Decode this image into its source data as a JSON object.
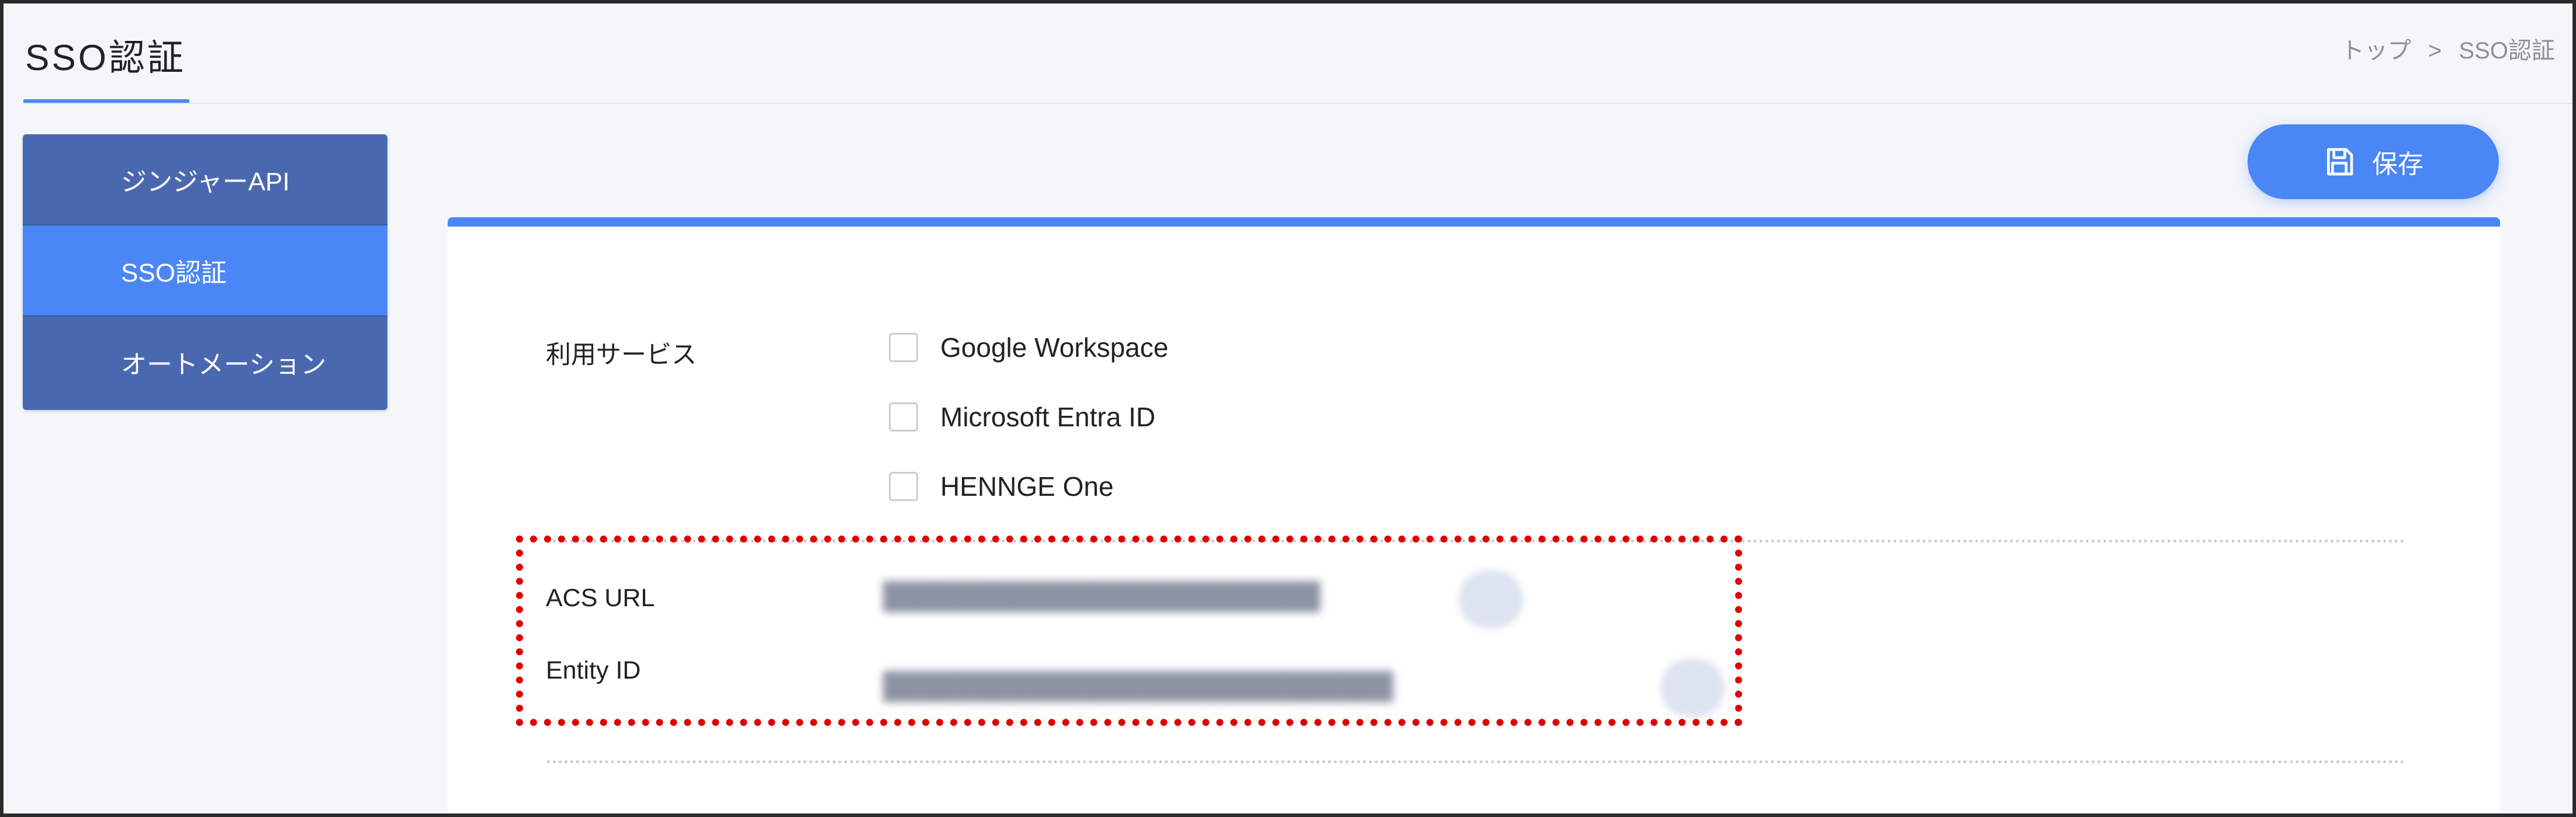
{
  "header": {
    "title": "SSO認証",
    "breadcrumb": {
      "top": "トップ",
      "separator": ">",
      "current": "SSO認証"
    }
  },
  "sidebar": {
    "items": [
      {
        "label": "ジンジャーAPI",
        "active": false
      },
      {
        "label": "SSO認証",
        "active": true
      },
      {
        "label": "オートメーション",
        "active": false
      }
    ]
  },
  "toolbar": {
    "save_label": "保存",
    "save_icon": "floppy-disk-icon"
  },
  "form": {
    "service_label": "利用サービス",
    "services": [
      {
        "label": "Google Workspace",
        "checked": false
      },
      {
        "label": "Microsoft Entra ID",
        "checked": false
      },
      {
        "label": "HENNGE One",
        "checked": false
      }
    ],
    "acs_url_label": "ACS URL",
    "entity_id_label": "Entity ID"
  },
  "colors": {
    "accent": "#4a86f5",
    "sidebar_bg": "#4a68b0",
    "highlight": "#e00000"
  }
}
